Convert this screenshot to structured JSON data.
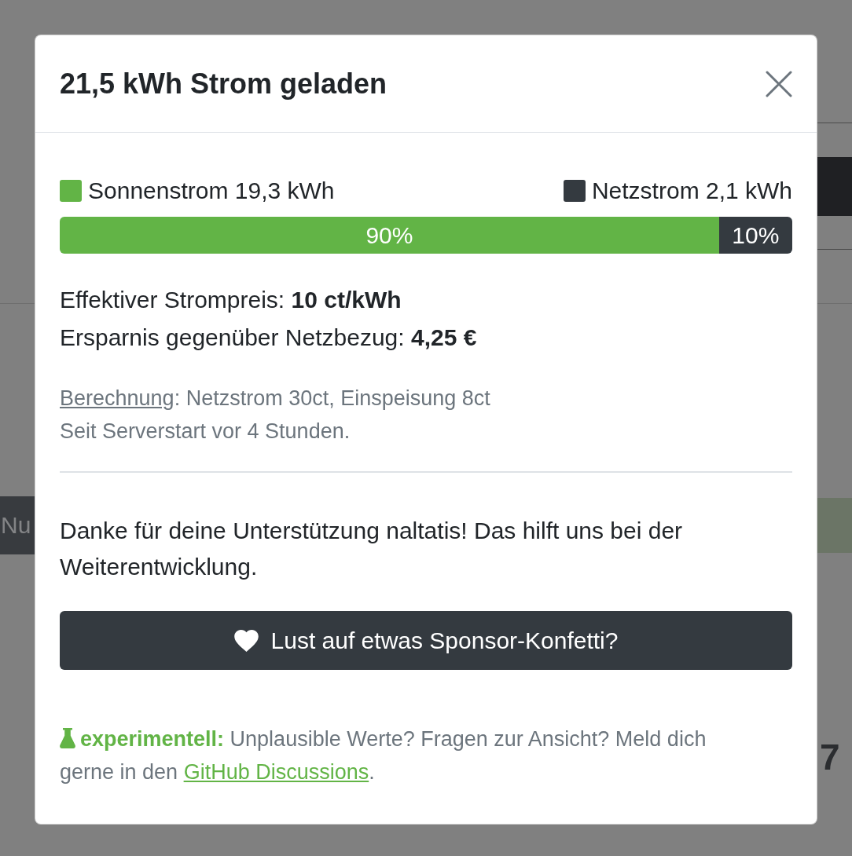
{
  "background": {
    "left_label": "Nu",
    "right_text": "7"
  },
  "dialog": {
    "title": "21,5 kWh Strom geladen",
    "legend": [
      {
        "label": "Sonnenstrom 19,3 kWh",
        "color": "#62b446"
      },
      {
        "label": "Netzstrom 2,1 kWh",
        "color": "#343a40"
      }
    ],
    "share_bar": [
      {
        "label": "90%",
        "level": 0.9,
        "color": "#62b446"
      },
      {
        "label": "10%",
        "level": 0.1,
        "color": "#343a40"
      }
    ],
    "stats": [
      "Effektiver Strompreis: **10 ct/kWh**",
      "Ersparnis gegenüber Netzbezug: **4,25 €**"
    ],
    "calculation": {
      "link": "Berechnung",
      "text": ": Netzstrom 30ct, Einspeisung 8ct"
    },
    "uptime": "Seit Serverstart vor 4 Stunden.",
    "thanks": "Danke für deine Unterstützung naltatis! Das hilft uns bei der Weiterentwicklung.",
    "sponsor_button": "Lust auf etwas Sponsor-Konfetti?",
    "note": {
      "text": "**experimentell:** Unplausible Werte? Fragen zur Ansicht? Meld dich gerne in den ",
      "link": "GitHub Discussions",
      "after": "."
    }
  }
}
